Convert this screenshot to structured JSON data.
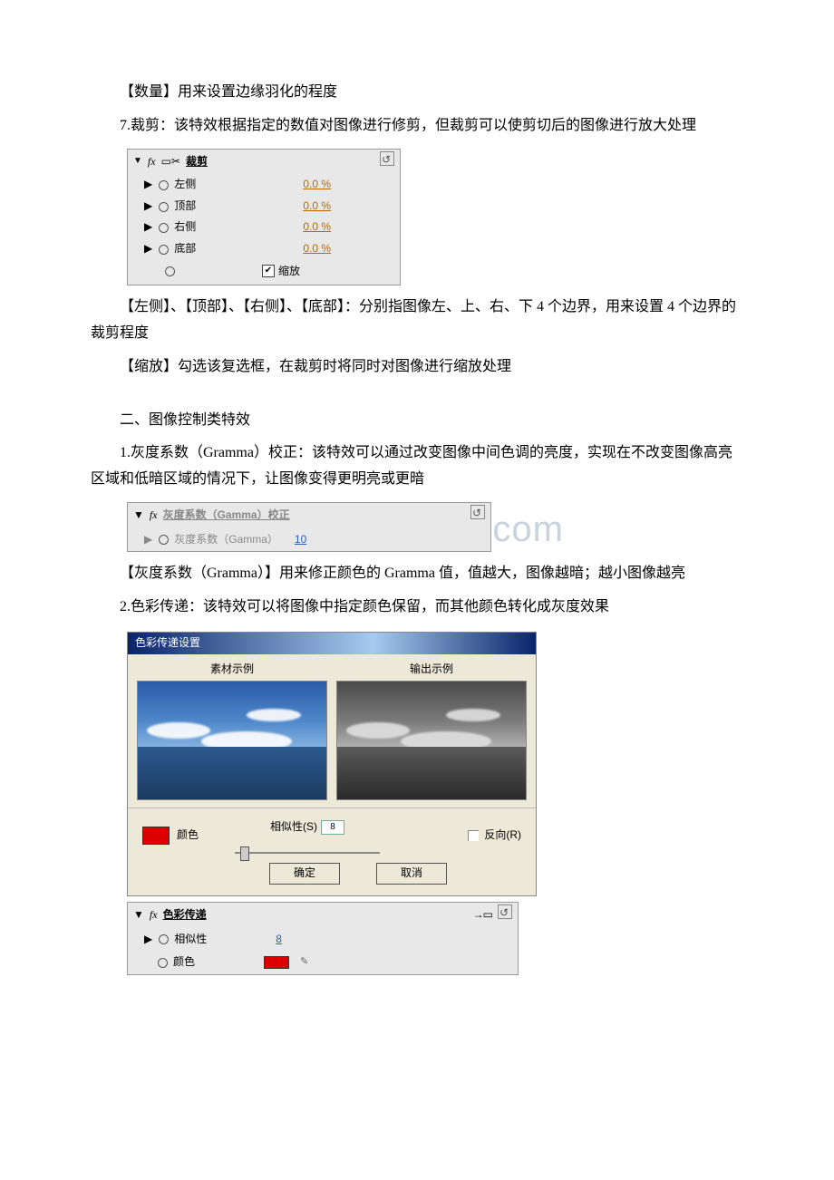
{
  "text": {
    "p1": "【数量】用来设置边缘羽化的程度",
    "p2": "7.裁剪：该特效根据指定的数值对图像进行修剪，但裁剪可以使剪切后的图像进行放大处理",
    "p3a": "【左侧】、【顶部】、【右侧】、【底部】：分别指图像左、上、右、下 4 个边界，用来设置 4 个边界的裁剪程度",
    "p4": "【缩放】勾选该复选框，在裁剪时将同时对图像进行缩放处理",
    "sec2": "二、图像控制类特效",
    "p5": "1.灰度系数（Gramma）校正：该特效可以通过改变图像中间色调的亮度，实现在不改变图像高亮区域和低暗区域的情况下，让图像变得更明亮或更暗",
    "p6": "【灰度系数（Gramma）】用来修正颜色的 Gramma 值，值越大，图像越暗；越小图像越亮",
    "p7": "2.色彩传递：该特效可以将图像中指定颜色保留，而其他颜色转化成灰度效果"
  },
  "crop_panel": {
    "title": "裁剪",
    "rows": [
      {
        "label": "左侧",
        "value": "0.0 %"
      },
      {
        "label": "顶部",
        "value": "0.0 %"
      },
      {
        "label": "右侧",
        "value": "0.0 %"
      },
      {
        "label": "底部",
        "value": "0.0 %"
      }
    ],
    "checkbox_label": "缩放"
  },
  "gamma_panel": {
    "title": "灰度系数（Gamma）校正",
    "row_label": "灰度系数（Gamma）",
    "value": "10"
  },
  "watermark": "www.bdocx.com",
  "color_dialog": {
    "title": "色彩传递设置",
    "col_left": "素材示例",
    "col_right": "输出示例",
    "color_label": "颜色",
    "similarity_label": "相似性(S)",
    "similarity_value": "8",
    "reverse_label": "反向(R)",
    "ok": "确定",
    "cancel": "取消"
  },
  "color_panel": {
    "title": "色彩传递",
    "sim_label": "相似性",
    "sim_value": "8",
    "color_label": "颜色"
  }
}
